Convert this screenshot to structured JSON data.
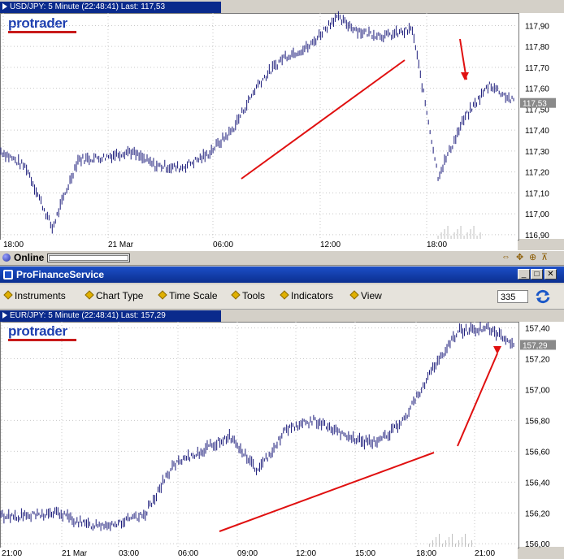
{
  "top_chart": {
    "title": "USD/JPY: 5 Minute (22:48:41) Last: 117,53",
    "logo": "protrader",
    "yticks": [
      "117,90",
      "117,80",
      "117,70",
      "117,60",
      "117,50",
      "117,40",
      "117,30",
      "117,20",
      "117,10",
      "117,00",
      "116,90"
    ],
    "xticks": [
      "18:00",
      "21 Mar",
      "06:00",
      "12:00",
      "18:00"
    ],
    "last": "117,53"
  },
  "status": {
    "label": "Online",
    "icons": [
      "resize-icon",
      "move-icon",
      "zoom-icon",
      "pin-icon"
    ]
  },
  "window": {
    "title": "ProFinanceService",
    "buttons": [
      "_",
      "□",
      "✕"
    ]
  },
  "menu": {
    "items": [
      "Instruments",
      "Chart Type",
      "Time Scale",
      "Tools",
      "Indicators",
      "View"
    ],
    "value": "335"
  },
  "bottom_chart": {
    "title": "EUR/JPY: 5 Minute (22:48:41) Last: 157,29",
    "logo": "protrader",
    "yticks": [
      "157,40",
      "157,20",
      "157,00",
      "156,80",
      "156,60",
      "156,40",
      "156,20",
      "156,00"
    ],
    "xticks": [
      "21:00",
      "21 Mar",
      "03:00",
      "06:00",
      "09:00",
      "12:00",
      "15:00",
      "18:00",
      "21:00"
    ],
    "last": "157,29"
  },
  "colors": {
    "title_bar": "#0a2a8c",
    "price_line": "#1a1a7a",
    "annotation": "#e01010",
    "logo": "#1d3fb0"
  },
  "chart_data": [
    {
      "type": "line",
      "title": "USD/JPY: 5 Minute (22:48:41) Last: 117,53",
      "x": [
        "18:00",
        "21 Mar",
        "06:00",
        "12:00",
        "18:00"
      ],
      "series": [
        {
          "values": [
            117.3,
            117.22,
            116.93,
            117.26,
            117.27,
            117.3,
            117.23,
            117.22,
            117.28,
            117.4,
            117.62,
            117.75,
            117.8,
            117.94,
            117.87,
            117.85,
            117.88,
            117.18,
            117.45,
            117.62,
            117.53
          ]
        }
      ],
      "ylim": [
        116.88,
        117.96
      ],
      "grid": true
    },
    {
      "type": "line",
      "title": "EUR/JPY: 5 Minute (22:48:41) Last: 157,29",
      "x": [
        "21:00",
        "21 Mar",
        "03:00",
        "06:00",
        "09:00",
        "12:00",
        "15:00",
        "18:00",
        "21:00"
      ],
      "series": [
        {
          "values": [
            156.18,
            156.18,
            156.2,
            156.12,
            156.13,
            156.18,
            156.5,
            156.6,
            156.7,
            156.47,
            156.75,
            156.8,
            156.7,
            156.65,
            156.77,
            157.1,
            157.38,
            157.4,
            157.29
          ]
        }
      ],
      "ylim": [
        155.98,
        157.44
      ],
      "grid": true
    }
  ]
}
